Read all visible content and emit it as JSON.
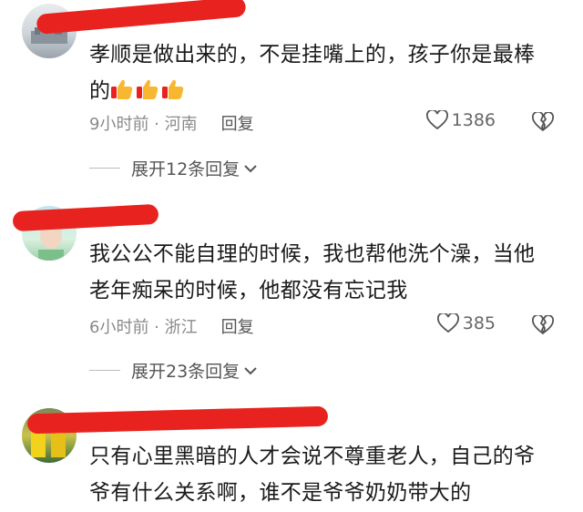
{
  "comments": [
    {
      "text_line1": "孝顺是做出来的，不是挂嘴上的，孩子你是最棒",
      "text_line2": "的",
      "time_location": "9小时前 · 河南",
      "reply_label": "回复",
      "likes": "1386",
      "expand_label": "展开12条回复",
      "emoji_count": 3
    },
    {
      "text_line1": "我公公不能自理的时候，我也帮他洗个澡，当他",
      "text_line2": "老年痴呆的时候，他都没有忘记我",
      "time_location": "6小时前 · 浙江",
      "reply_label": "回复",
      "likes": "385",
      "expand_label": "展开23条回复"
    },
    {
      "text_line1": "只有心里黑暗的人才会说不尊重老人，自己的爷",
      "text_line2": "爷有什么关系啊，谁不是爷爷奶奶带大的"
    }
  ],
  "icons": {
    "like": "heart-outline-icon",
    "dislike": "broken-heart-icon",
    "expand": "chevron-down-icon",
    "emoji": "thumbs-up-emoji"
  },
  "colors": {
    "redaction": "#e8231f",
    "text": "#1a1a1a",
    "meta": "#8a8a8a"
  }
}
